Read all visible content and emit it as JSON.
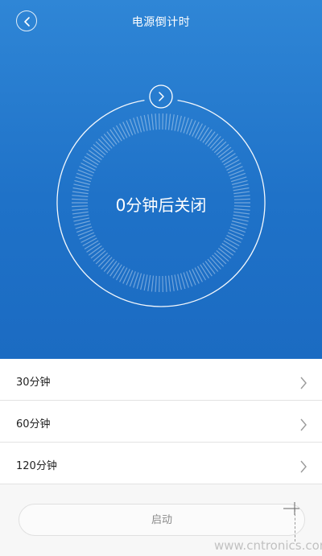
{
  "header": {
    "title": "电源倒计时",
    "back_icon": "chevron-left-icon",
    "bg_color": "#1f72c8"
  },
  "dial": {
    "status_text": "0分钟后关闭",
    "handle_icon": "chevron-right-icon",
    "value_minutes": 0
  },
  "presets": [
    {
      "label": "30分钟"
    },
    {
      "label": "60分钟"
    },
    {
      "label": "120分钟"
    }
  ],
  "start_button": {
    "label": "启动"
  },
  "watermark": "www.cntronics.com"
}
